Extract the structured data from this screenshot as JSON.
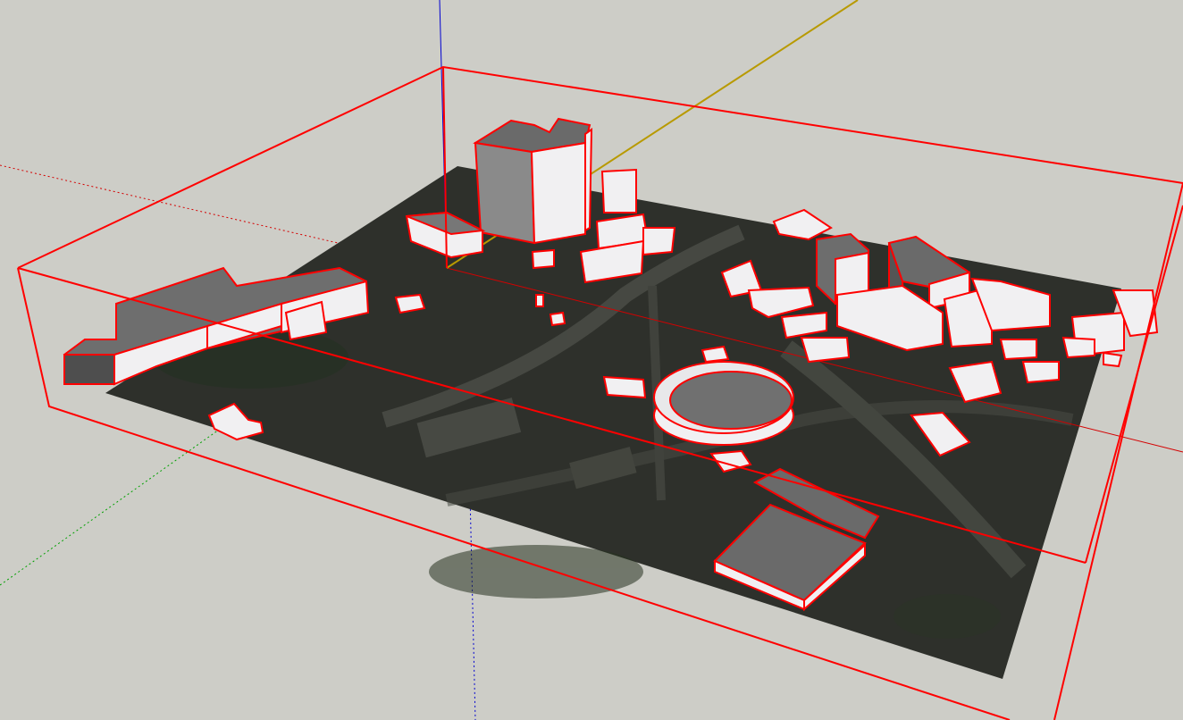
{
  "app": "SketchUp",
  "colors": {
    "background": "#cdcdc7",
    "selection": "#ff0000",
    "axis_red": "#d40000",
    "axis_green": "#00a000",
    "axis_blue": "#0000d0",
    "axis_yellow": "#b89a00",
    "building_top": "#7a7a7a",
    "building_side_light": "#f1f0f2",
    "building_side_dark": "#555555",
    "terrain": "#2e302b"
  },
  "scene": {
    "selection_state": "all-selected",
    "objects": [
      "terrain-aerial-image",
      "tower-building",
      "mid-rise-building",
      "long-wing-building",
      "stadium-building",
      "plaza-building",
      "small-buildings"
    ]
  }
}
